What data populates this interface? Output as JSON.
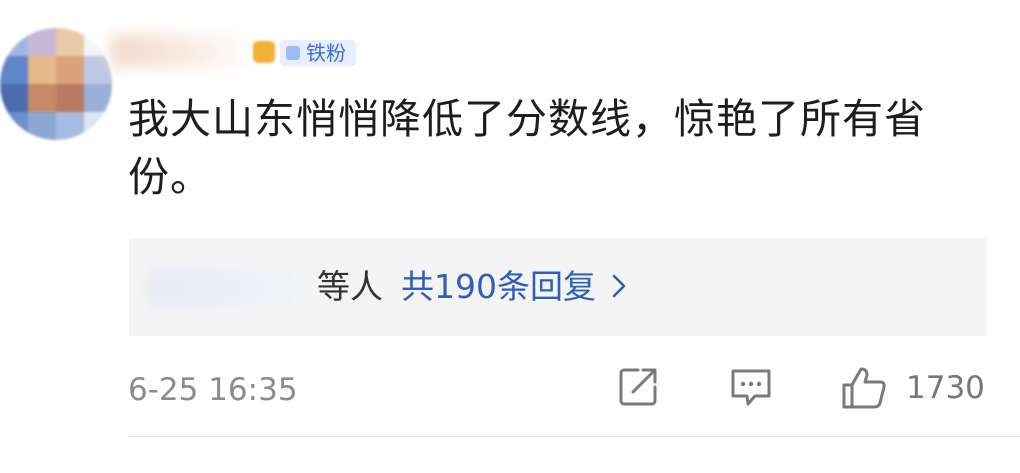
{
  "comment": {
    "badge_label": "铁粉",
    "text": "我大山东悄悄降低了分数线，惊艳了所有省份。",
    "reply_summary": {
      "names_suffix": "等人",
      "count_label": "共190条回复"
    },
    "timestamp": "6-25 16:35",
    "like_count": "1730"
  },
  "icons": {
    "share": "share-icon",
    "reply": "comment-icon",
    "like": "thumbs-up-icon",
    "more": "chevron-right-icon"
  },
  "colors": {
    "link": "#2f5fb9",
    "badge_bg": "#e7efff",
    "badge_text": "#3a6fd8",
    "muted": "#8c8c8c"
  }
}
